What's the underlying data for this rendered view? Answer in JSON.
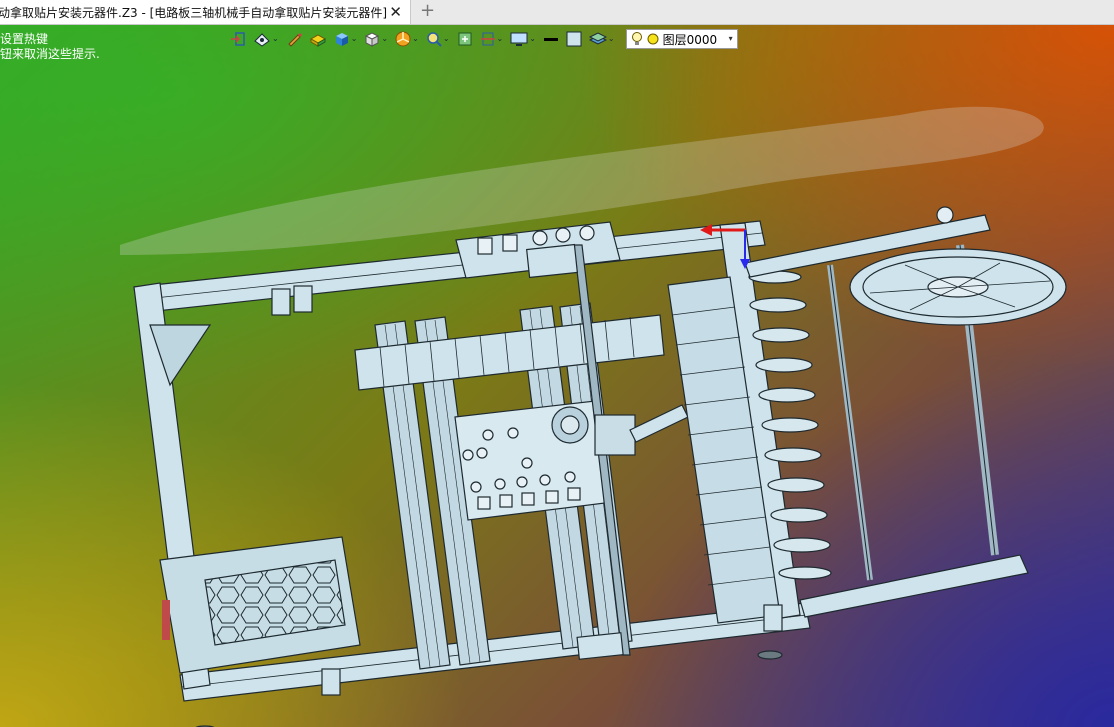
{
  "tab": {
    "title": "动拿取贴片安装元器件.Z3 - [电路板三轴机械手自动拿取贴片安装元器件]",
    "close_glyph": "✕",
    "add_glyph": "+"
  },
  "hints": {
    "line1": "设置热键",
    "line2": "钮来取消这些提示."
  },
  "toolbar": {
    "icons": [
      "exit-icon",
      "view-icon",
      "pen-icon",
      "yellow-block-icon",
      "blue-cube-icon",
      "white-cube-icon",
      "orange-pie-icon",
      "zoom-icon",
      "fit-icon",
      "section-icon",
      "monitor-icon",
      "line-style-icon",
      "fill-color-icon",
      "layers-stack-icon"
    ],
    "layer": {
      "name": "图层0000",
      "bulb_icon": "light-bulb-icon",
      "color_icon": "yellow-dot-icon"
    }
  },
  "colors": {
    "model_fill": "#cfe3ec",
    "model_edge": "#1e2a30",
    "axis_red": "#e01818",
    "axis_blue": "#2a2aee",
    "toolbar_icon": "#1b2a3a"
  }
}
